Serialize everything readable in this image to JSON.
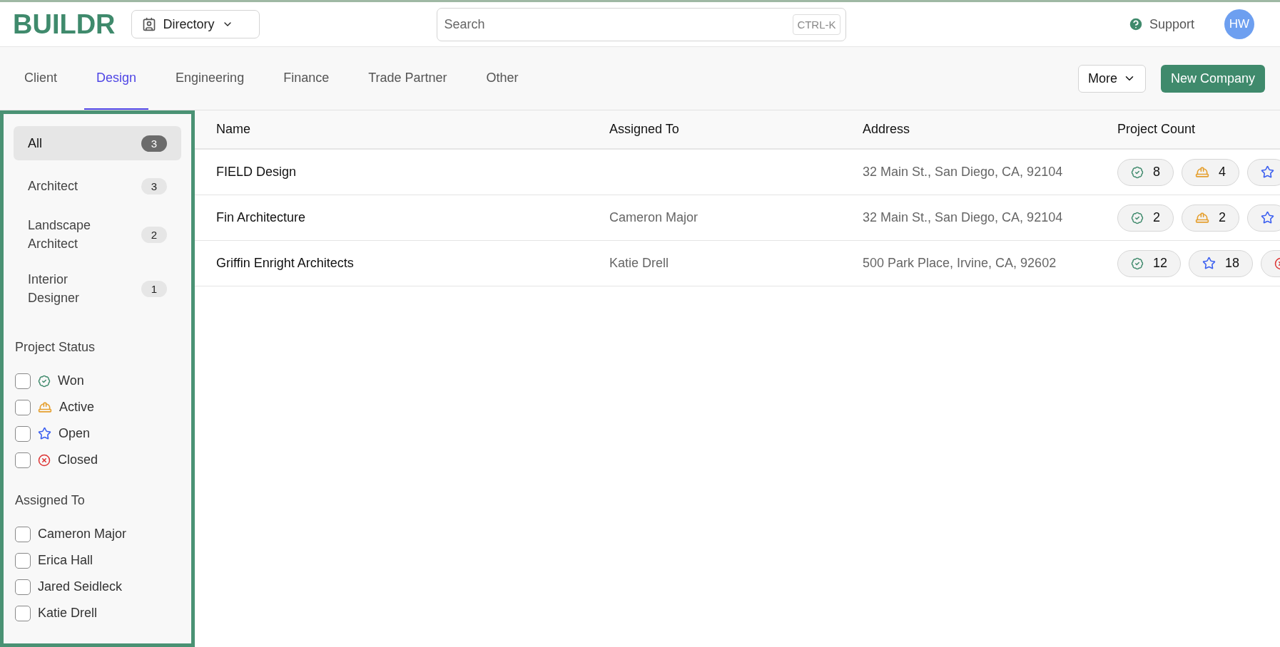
{
  "header": {
    "logo": "BUILDR",
    "module": "Directory",
    "search": {
      "placeholder": "Search",
      "shortcut": "CTRL-K"
    },
    "support": "Support",
    "avatar": "HW"
  },
  "tabs": [
    {
      "label": "Client",
      "selected": false
    },
    {
      "label": "Design",
      "selected": true
    },
    {
      "label": "Engineering",
      "selected": false
    },
    {
      "label": "Finance",
      "selected": false
    },
    {
      "label": "Trade Partner",
      "selected": false
    },
    {
      "label": "Other",
      "selected": false
    }
  ],
  "actions": {
    "more": "More",
    "primary": "New Company"
  },
  "sidebar": {
    "categories": [
      {
        "label": "All",
        "count": "3",
        "selected": true
      },
      {
        "label": "Architect",
        "count": "3",
        "selected": false
      },
      {
        "label": "Landscape Architect",
        "count": "2",
        "selected": false
      },
      {
        "label": "Interior Designer",
        "count": "1",
        "selected": false
      }
    ],
    "status_title": "Project Status",
    "statuses": [
      {
        "kind": "won",
        "label": "Won",
        "checked": false
      },
      {
        "kind": "active",
        "label": "Active",
        "checked": false
      },
      {
        "kind": "open",
        "label": "Open",
        "checked": false
      },
      {
        "kind": "closed",
        "label": "Closed",
        "checked": false
      }
    ],
    "assigned_title": "Assigned To",
    "assignees": [
      {
        "label": "Cameron Major",
        "checked": false
      },
      {
        "label": "Erica Hall",
        "checked": false
      },
      {
        "label": "Jared Seidleck",
        "checked": false
      },
      {
        "label": "Katie Drell",
        "checked": false
      }
    ]
  },
  "table": {
    "columns": [
      "Name",
      "Assigned To",
      "Address",
      "Project Count"
    ],
    "rows": [
      {
        "name": "FIELD Design",
        "address": "32 Main St., San Diego, CA, 92104",
        "counts": [
          {
            "kind": "won",
            "count": "8"
          },
          {
            "kind": "active",
            "count": "4"
          },
          {
            "kind": "open"
          }
        ]
      },
      {
        "name": "Fin Architecture",
        "assigned": "Cameron Major",
        "address": "32 Main St., San Diego, CA, 92104",
        "counts": [
          {
            "kind": "won",
            "count": "2"
          },
          {
            "kind": "active",
            "count": "2"
          },
          {
            "kind": "open"
          }
        ]
      },
      {
        "name": "Griffin Enright Architects",
        "assigned": "Katie Drell",
        "address": "500 Park Place, Irvine, CA, 92602",
        "counts": [
          {
            "kind": "won",
            "count": "12"
          },
          {
            "kind": "open",
            "count": "18"
          },
          {
            "kind": "closed"
          }
        ]
      }
    ]
  }
}
